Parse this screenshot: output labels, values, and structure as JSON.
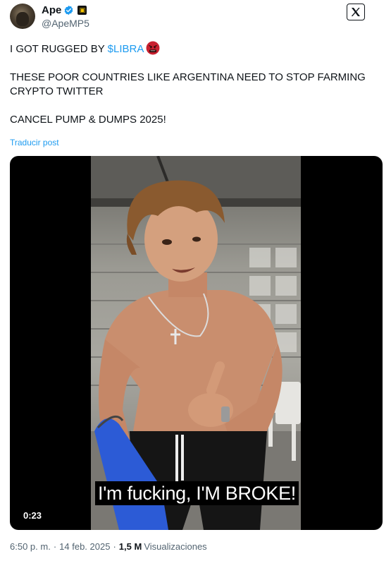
{
  "author": {
    "display_name": "Ape",
    "handle": "@ApeMP5",
    "verified_icon": "verified-badge-icon",
    "affiliate_icon": "affiliate-badge-icon"
  },
  "header": {
    "logo_icon": "x-logo-icon"
  },
  "tweet": {
    "line1_prefix": "I GOT RUGGED BY ",
    "line1_cashtag": "$LIBRA",
    "line1_emoji": "angry-face-emoji",
    "line2": "THESE POOR COUNTRIES LIKE ARGENTINA NEED TO STOP FARMING CRYPTO TWITTER",
    "line3": "CANCEL PUMP & DUMPS 2025!",
    "translate_label": "Traducir post"
  },
  "video": {
    "caption": "I'm fucking, I'M BROKE!",
    "duration": "0:23"
  },
  "meta": {
    "time": "6:50 p. m.",
    "separator": "·",
    "date": "14 feb. 2025",
    "views_count": "1,5 M",
    "views_label": "Visualizaciones"
  },
  "colors": {
    "accent": "#1d9bf0",
    "text": "#0f1419",
    "muted": "#536471"
  }
}
